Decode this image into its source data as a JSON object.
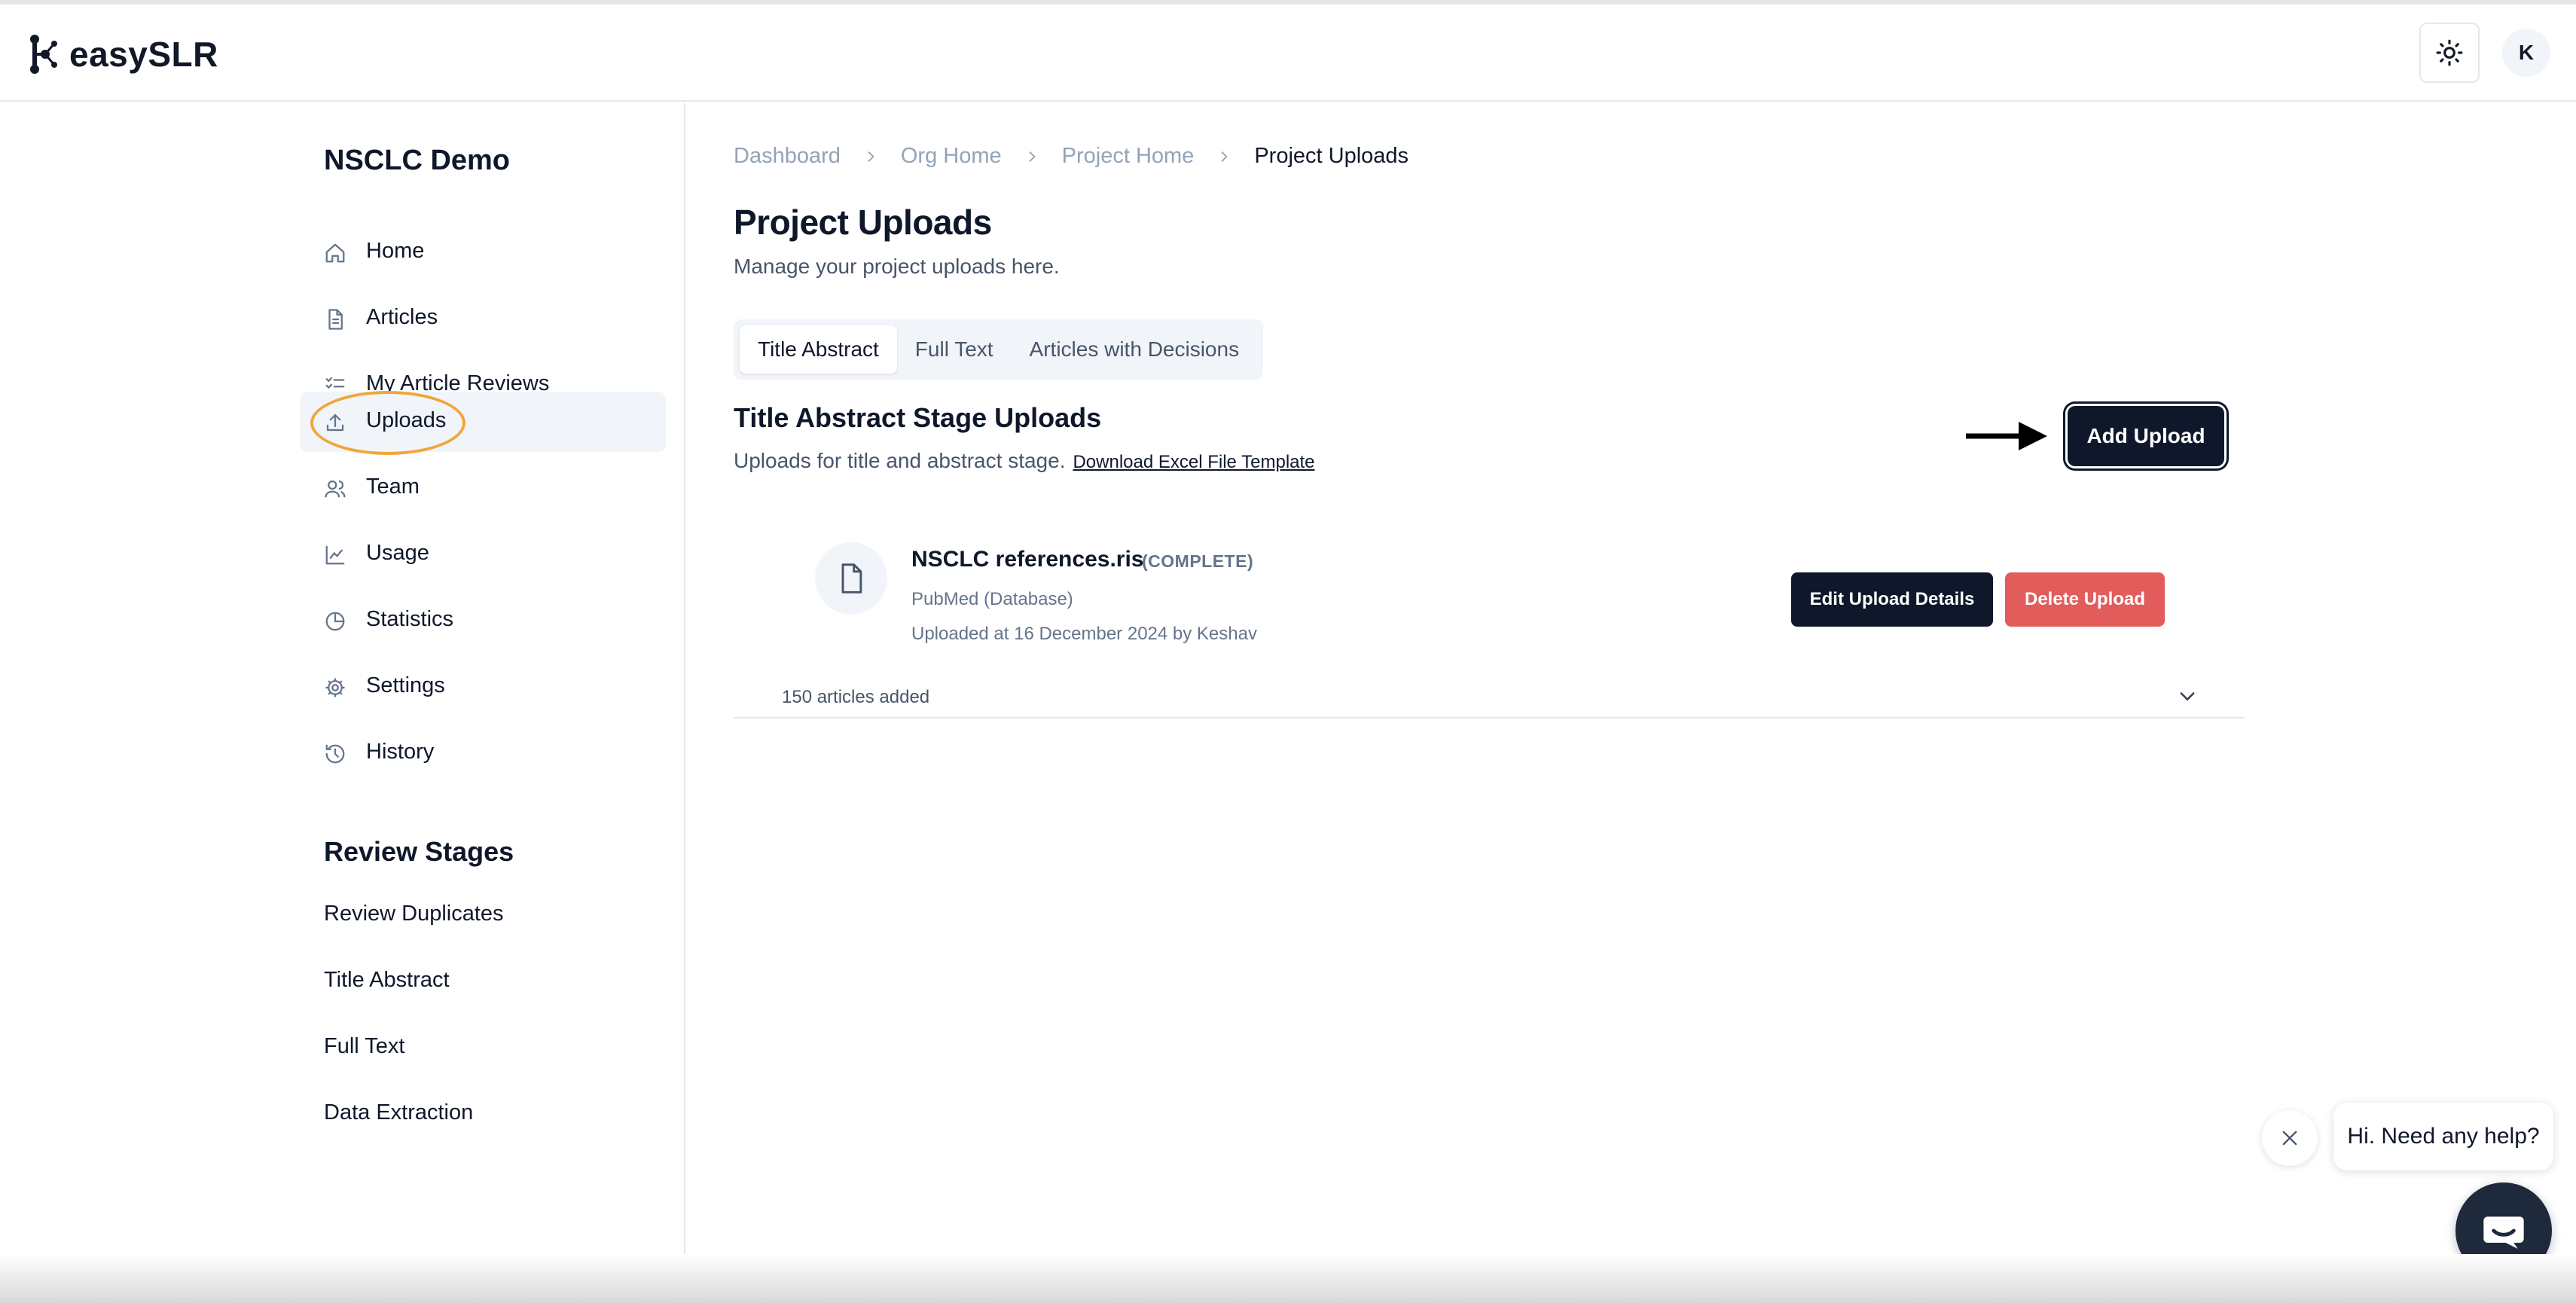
{
  "header": {
    "app_name": "easySLR",
    "avatar_initial": "K"
  },
  "sidebar": {
    "project_name": "NSCLC Demo",
    "items": [
      {
        "label": "Home",
        "icon": "home-icon"
      },
      {
        "label": "Articles",
        "icon": "document-icon"
      },
      {
        "label": "My Article Reviews",
        "icon": "checklist-icon"
      },
      {
        "label": "Uploads",
        "icon": "upload-icon",
        "active": true
      },
      {
        "label": "Team",
        "icon": "users-icon"
      },
      {
        "label": "Usage",
        "icon": "line-chart-icon"
      },
      {
        "label": "Statistics",
        "icon": "pie-chart-icon"
      },
      {
        "label": "Settings",
        "icon": "gear-icon"
      },
      {
        "label": "History",
        "icon": "history-icon"
      }
    ],
    "review_stages_title": "Review Stages",
    "stages": [
      "Review Duplicates",
      "Title Abstract",
      "Full Text",
      "Data Extraction"
    ]
  },
  "breadcrumb": [
    "Dashboard",
    "Org Home",
    "Project Home",
    "Project Uploads"
  ],
  "page": {
    "title": "Project Uploads",
    "subtitle": "Manage your project uploads here."
  },
  "tabs": [
    {
      "label": "Title Abstract",
      "active": true
    },
    {
      "label": "Full Text",
      "active": false
    },
    {
      "label": "Articles with Decisions",
      "active": false
    }
  ],
  "stage": {
    "title": "Title Abstract Stage Uploads",
    "subtitle": "Uploads for title and abstract stage.",
    "template_link": "Download Excel File Template",
    "add_button": "Add Upload"
  },
  "upload": {
    "file_name": "NSCLC references.ris",
    "status": "(COMPLETE)",
    "source": "PubMed (Database)",
    "meta": "Uploaded at 16 December 2024 by Keshav",
    "edit_button": "Edit Upload Details",
    "delete_button": "Delete Upload",
    "articles_added": "150 articles added"
  },
  "help": {
    "message": "Hi. Need any help?"
  },
  "colors": {
    "primary": "#0f172a",
    "danger": "#e25c5c",
    "highlight": "#f0a63b",
    "muted": "#64748b"
  }
}
